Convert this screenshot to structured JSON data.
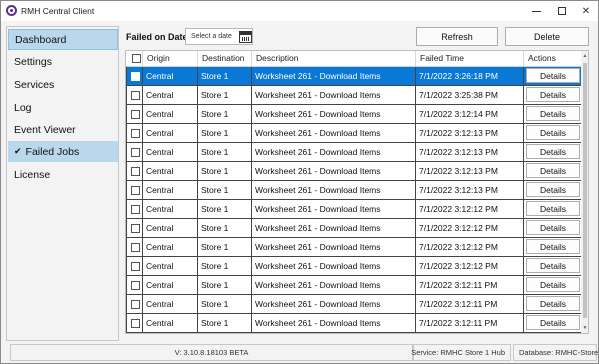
{
  "window": {
    "title": "RMH Central Client",
    "accent_color": "#0a78d7",
    "nav_highlight_color": "#b9d8ec"
  },
  "sidebar": {
    "items": [
      {
        "label": "Dashboard",
        "state": "focused"
      },
      {
        "label": "Settings",
        "state": ""
      },
      {
        "label": "Services",
        "state": ""
      },
      {
        "label": "Log",
        "state": ""
      },
      {
        "label": "Event Viewer",
        "state": ""
      },
      {
        "label": "Failed Jobs",
        "state": "selected",
        "check": "✔"
      },
      {
        "label": "License",
        "state": ""
      }
    ]
  },
  "filter": {
    "label": "Failed on Date:",
    "date_placeholder": "Select a date",
    "calendar_icon": "calendar-icon"
  },
  "toolbar": {
    "refresh_label": "Refresh",
    "delete_label": "Delete"
  },
  "table": {
    "columns": [
      "",
      "Origin",
      "Destination",
      "Description",
      "Failed Time",
      "Actions"
    ],
    "rows": [
      {
        "origin": "Central",
        "destination": "Store 1",
        "description": "Worksheet 261 - Download Items",
        "failed_time": "7/1/2022 3:26:18 PM",
        "action": "Details",
        "selected": true
      },
      {
        "origin": "Central",
        "destination": "Store 1",
        "description": "Worksheet 261 - Download Items",
        "failed_time": "7/1/2022 3:25:38 PM",
        "action": "Details",
        "selected": false
      },
      {
        "origin": "Central",
        "destination": "Store 1",
        "description": "Worksheet 261 - Download Items",
        "failed_time": "7/1/2022 3:12:14 PM",
        "action": "Details",
        "selected": false
      },
      {
        "origin": "Central",
        "destination": "Store 1",
        "description": "Worksheet 261 - Download Items",
        "failed_time": "7/1/2022 3:12:13 PM",
        "action": "Details",
        "selected": false
      },
      {
        "origin": "Central",
        "destination": "Store 1",
        "description": "Worksheet 261 - Download Items",
        "failed_time": "7/1/2022 3:12:13 PM",
        "action": "Details",
        "selected": false
      },
      {
        "origin": "Central",
        "destination": "Store 1",
        "description": "Worksheet 261 - Download Items",
        "failed_time": "7/1/2022 3:12:13 PM",
        "action": "Details",
        "selected": false
      },
      {
        "origin": "Central",
        "destination": "Store 1",
        "description": "Worksheet 261 - Download Items",
        "failed_time": "7/1/2022 3:12:13 PM",
        "action": "Details",
        "selected": false
      },
      {
        "origin": "Central",
        "destination": "Store 1",
        "description": "Worksheet 261 - Download Items",
        "failed_time": "7/1/2022 3:12:12 PM",
        "action": "Details",
        "selected": false
      },
      {
        "origin": "Central",
        "destination": "Store 1",
        "description": "Worksheet 261 - Download Items",
        "failed_time": "7/1/2022 3:12:12 PM",
        "action": "Details",
        "selected": false
      },
      {
        "origin": "Central",
        "destination": "Store 1",
        "description": "Worksheet 261 - Download Items",
        "failed_time": "7/1/2022 3:12:12 PM",
        "action": "Details",
        "selected": false
      },
      {
        "origin": "Central",
        "destination": "Store 1",
        "description": "Worksheet 261 - Download Items",
        "failed_time": "7/1/2022 3:12:12 PM",
        "action": "Details",
        "selected": false
      },
      {
        "origin": "Central",
        "destination": "Store 1",
        "description": "Worksheet 261 - Download Items",
        "failed_time": "7/1/2022 3:12:11 PM",
        "action": "Details",
        "selected": false
      },
      {
        "origin": "Central",
        "destination": "Store 1",
        "description": "Worksheet 261 - Download Items",
        "failed_time": "7/1/2022 3:12:11 PM",
        "action": "Details",
        "selected": false
      },
      {
        "origin": "Central",
        "destination": "Store 1",
        "description": "Worksheet 261 - Download Items",
        "failed_time": "7/1/2022 3:12:11 PM",
        "action": "Details",
        "selected": false
      }
    ]
  },
  "status": {
    "version": "V: 3.10.8.18103 BETA",
    "service": "Service: RMHC Store 1 Hub",
    "database": "Database: RMHC-Store1"
  }
}
